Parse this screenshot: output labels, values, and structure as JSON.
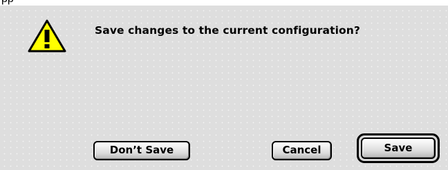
{
  "dialog": {
    "message": "Save changes to the current configuration?",
    "icon": "warning-icon",
    "icon_color": "#ffff00"
  },
  "buttons": {
    "dont_save_label": "Don’t Save",
    "cancel_label": "Cancel",
    "save_label": "Save",
    "default": "save"
  }
}
